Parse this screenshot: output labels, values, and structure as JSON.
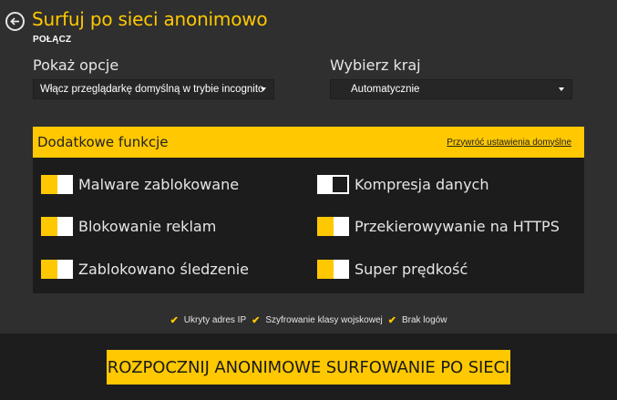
{
  "header": {
    "title": "Surfuj po sieci anonimowo",
    "subtitle": "POŁĄCZ"
  },
  "options": {
    "show_label": "Pokaż opcje",
    "show_value": "Włącz przeglądarkę domyślną w trybie incognito",
    "country_label": "Wybierz kraj",
    "country_value": "Automatycznie"
  },
  "panel": {
    "title": "Dodatkowe funkcje",
    "reset_link": "Przywróć ustawienia domyślne",
    "items": [
      {
        "label": "Malware zablokowane",
        "enabled": true
      },
      {
        "label": "Blokowanie reklam",
        "enabled": true
      },
      {
        "label": "Zablokowano śledzenie",
        "enabled": true
      },
      {
        "label": "Kompresja danych",
        "enabled": false
      },
      {
        "label": "Przekierowywanie na HTTPS",
        "enabled": true
      },
      {
        "label": "Super prędkość",
        "enabled": true
      }
    ]
  },
  "features": [
    "Ukryty adres IP",
    "Szyfrowanie klasy wojskowej",
    "Brak logów"
  ],
  "cta": {
    "label": "ROZPOCZNIJ ANONIMOWE SURFOWANIE PO SIECI"
  },
  "colors": {
    "accent": "#ffc800",
    "background": "#2f2f2f",
    "panel": "#1c1c1c"
  }
}
